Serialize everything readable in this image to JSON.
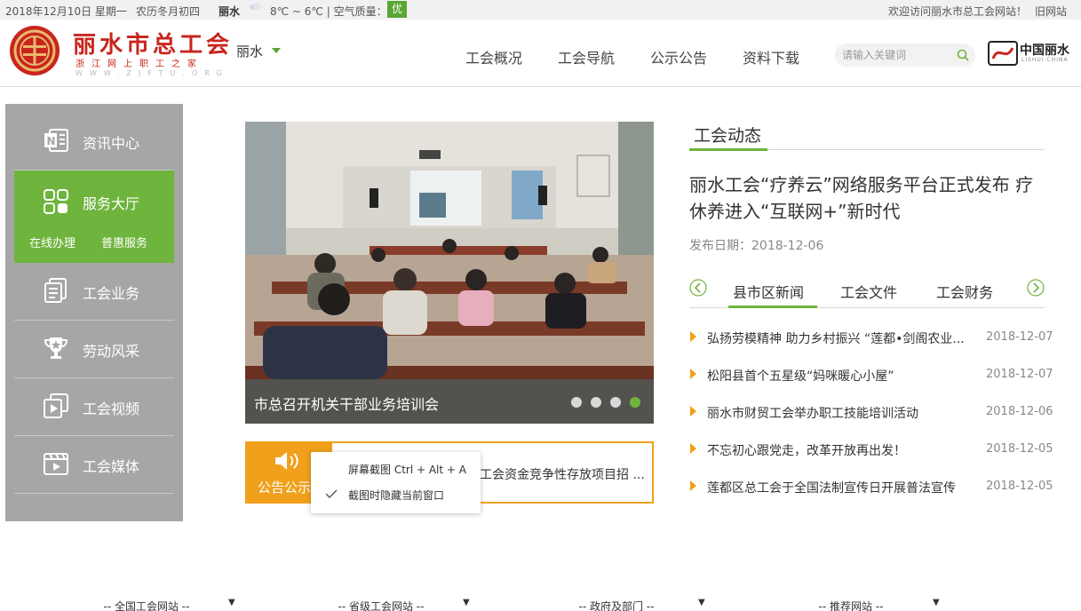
{
  "topbar": {
    "date": "2018年12月10日 星期一",
    "lunar": "农历冬月初四",
    "city": "丽水",
    "temperature": "8℃ ~ 6℃ | 空气质量：",
    "air_quality": "优",
    "welcome": "欢迎访问丽水市总工会网站！",
    "old_site": "旧网站"
  },
  "header": {
    "logo_title": "丽水市总工会",
    "logo_subtitle": "浙江网上职工之家",
    "logo_url": "WWW.ZJFTU.ORG",
    "region": "丽水",
    "nav": [
      "工会概况",
      "工会导航",
      "公示公告",
      "资料下载"
    ],
    "search_placeholder": "请输入关键词",
    "china_logo_text": "中国丽水",
    "china_logo_sub": "LISHUI·CHINA"
  },
  "sidebar": {
    "items": [
      {
        "label": "资讯中心",
        "icon": "onenote-icon"
      },
      {
        "label": "服务大厅",
        "icon": "grid-icon"
      },
      {
        "label": "工会业务",
        "icon": "document-icon"
      },
      {
        "label": "劳动风采",
        "icon": "trophy-icon"
      },
      {
        "label": "工会视频",
        "icon": "video-icon"
      },
      {
        "label": "工会媒体",
        "icon": "media-icon"
      }
    ],
    "service_sub": [
      "在线办理",
      "普惠服务"
    ]
  },
  "slideshow": {
    "caption": "市总召开机关干部业务培训会",
    "slide_count": 4,
    "active_index": 3
  },
  "notice": {
    "label": "公告公示",
    "text": "工会资金竞争性存放项目招 ..."
  },
  "context_menu": {
    "items": [
      "屏幕截图 Ctrl + Alt + A",
      "截图时隐藏当前窗口"
    ]
  },
  "news": {
    "section_title": "工会动态",
    "headline": "丽水工会“疗养云”网络服务平台正式发布 疗休养进入“互联网+”新时代",
    "pubdate": "发布日期：2018-12-06",
    "tabs": [
      "县市区新闻",
      "工会文件",
      "工会财务"
    ],
    "items": [
      {
        "title": "弘扬劳模精神 助力乡村振兴 “莲都•剑阁农业...",
        "date": "2018-12-07"
      },
      {
        "title": "松阳县首个五星级“妈咪暖心小屋”",
        "date": "2018-12-07"
      },
      {
        "title": "丽水市财贸工会举办职工技能培训活动",
        "date": "2018-12-06"
      },
      {
        "title": "不忘初心跟党走，改革开放再出发！",
        "date": "2018-12-05"
      },
      {
        "title": "莲都区总工会于全国法制宣传日开展普法宣传",
        "date": "2018-12-05"
      }
    ]
  },
  "footer": {
    "selects": [
      "-- 全国工会网站 --",
      "-- 省级工会网站 --",
      "-- 政府及部门 --",
      "-- 推荐网站 --"
    ]
  },
  "colors": {
    "accent_green": "#6fb43d",
    "accent_orange": "#f0a01a",
    "brand_red": "#c8251d",
    "sidebar_gray": "#a6a6a6"
  }
}
